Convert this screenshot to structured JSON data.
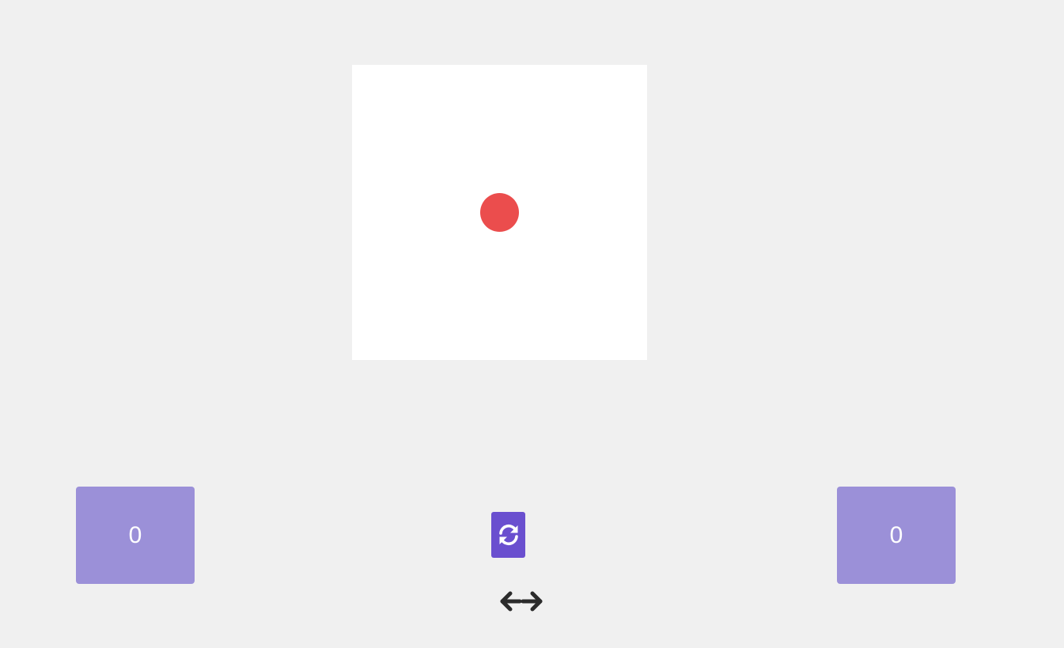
{
  "game": {
    "ball_color": "#eb4d4d",
    "board_color": "#ffffff",
    "background_color": "#f0f0f0"
  },
  "scores": {
    "left": "0",
    "right": "0",
    "box_color": "#9b90d8"
  },
  "controls": {
    "refresh_icon": "refresh-icon",
    "refresh_color": "#6a4fcf",
    "arrows_icon": "left-right-arrows-icon",
    "arrows_color": "#2b2b2b"
  }
}
